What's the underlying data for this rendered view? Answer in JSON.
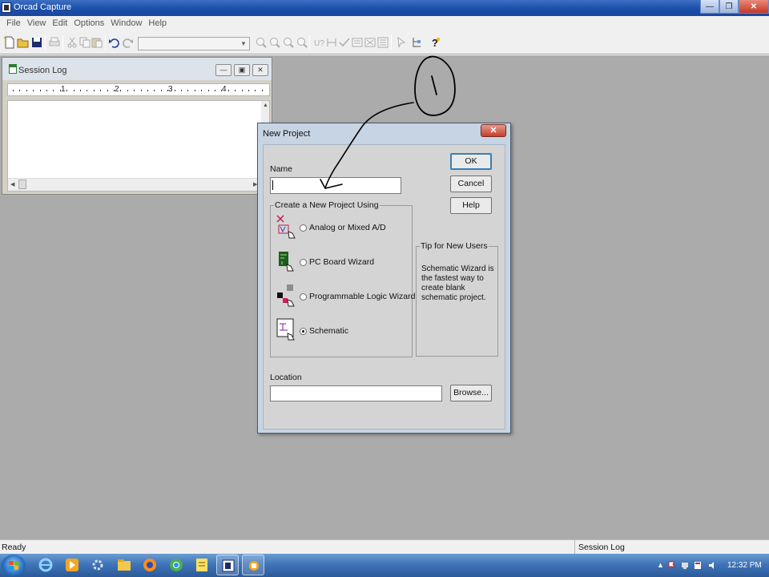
{
  "app": {
    "title": "Orcad Capture"
  },
  "menu": [
    "File",
    "View",
    "Edit",
    "Options",
    "Window",
    "Help"
  ],
  "toolbar": {
    "icons": [
      "new-icon",
      "open-icon",
      "save-icon",
      "print-icon",
      "cut-icon",
      "copy-icon",
      "paste-icon",
      "undo-icon",
      "redo-icon",
      "zoom-in-icon",
      "zoom-out-icon",
      "zoom-area-icon",
      "zoom-all-icon",
      "annotate-icon",
      "back-annotate-icon",
      "drc-icon",
      "netlist-icon",
      "cross-reference-icon",
      "bill-of-materials-icon",
      "snap-to-grid-icon",
      "project-manager-icon",
      "help-icon"
    ],
    "part_combo_value": ""
  },
  "session_log": {
    "title": "Session Log",
    "ruler_numbers": [
      "1",
      "2",
      "3",
      "4"
    ]
  },
  "dialog": {
    "title": "New Project",
    "name_label": "Name",
    "name_value": "",
    "ok_label": "OK",
    "cancel_label": "Cancel",
    "help_label": "Help",
    "group_label": "Create a New Project Using",
    "options": [
      {
        "label": "Analog or Mixed A/D",
        "checked": false
      },
      {
        "label": "PC Board Wizard",
        "checked": false
      },
      {
        "label": "Programmable Logic Wizard",
        "checked": false
      },
      {
        "label": "Schematic",
        "checked": true
      }
    ],
    "tip_title": "Tip for New Users",
    "tip_text": "Schematic Wizard is the fastest way to create blank schematic project.",
    "location_label": "Location",
    "location_value": "",
    "browse_label": "Browse..."
  },
  "status": {
    "left": "Ready",
    "right": "Session Log"
  },
  "taskbar": {
    "time": "12:32 PM"
  },
  "colors": {
    "titlebar": "#1b4fa8",
    "workspace": "#ababab",
    "dialog_frame": "#c7d4e3",
    "annotation": "#000000"
  }
}
